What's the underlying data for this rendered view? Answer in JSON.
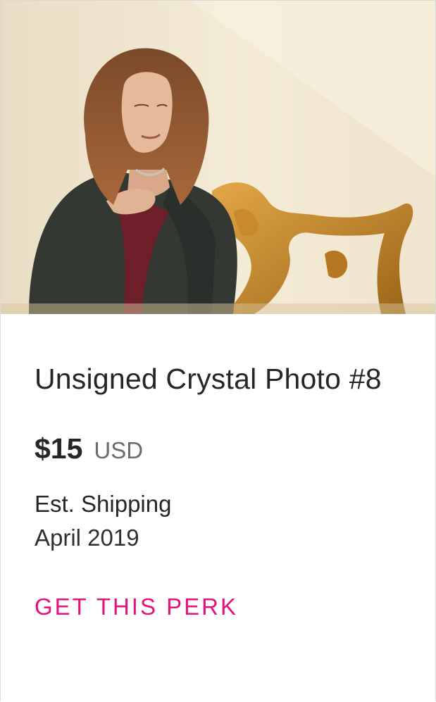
{
  "perk": {
    "image_alt": "Photo of woman in leather jacket seated on ornate gold chair",
    "title": "Unsigned Crystal Photo #8",
    "price": {
      "amount": "$15",
      "currency": "USD"
    },
    "shipping": {
      "label": "Est. Shipping",
      "date": "April 2019"
    },
    "cta_label": "GET THIS PERK"
  },
  "colors": {
    "accent": "#e5127b",
    "text": "#262626",
    "muted": "#6b6b6b",
    "border": "#d9d9d9"
  }
}
